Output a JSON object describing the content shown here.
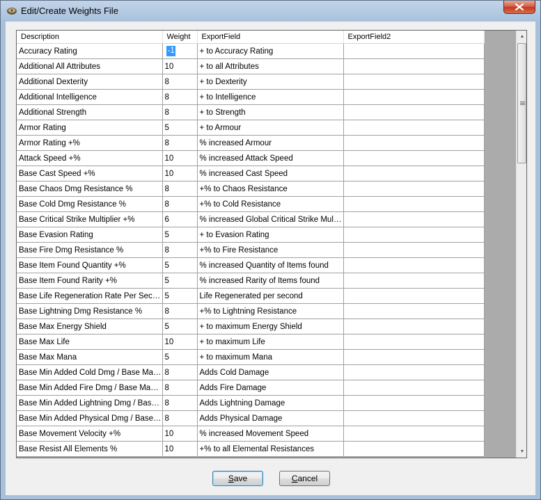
{
  "window": {
    "title": "Edit/Create Weights File",
    "close_glyph": "✕"
  },
  "table": {
    "columns": [
      "Description",
      "Weight",
      "ExportField",
      "ExportField2"
    ],
    "rows": [
      [
        "Accuracy Rating",
        "-1",
        "+ to Accuracy Rating",
        ""
      ],
      [
        "Additional All Attributes",
        "10",
        "+ to all Attributes",
        ""
      ],
      [
        "Additional Dexterity",
        "8",
        "+ to Dexterity",
        ""
      ],
      [
        "Additional Intelligence",
        "8",
        "+ to Intelligence",
        ""
      ],
      [
        "Additional Strength",
        "8",
        "+ to Strength",
        ""
      ],
      [
        "Armor Rating",
        "5",
        "+ to Armour",
        ""
      ],
      [
        "Armor Rating +%",
        "8",
        "% increased Armour",
        ""
      ],
      [
        "Attack Speed +%",
        "10",
        "% increased Attack Speed",
        ""
      ],
      [
        "Base Cast Speed +%",
        "10",
        "% increased Cast Speed",
        ""
      ],
      [
        "Base Chaos Dmg Resistance %",
        "8",
        "+% to Chaos Resistance",
        ""
      ],
      [
        "Base Cold Dmg Resistance %",
        "8",
        "+% to Cold Resistance",
        ""
      ],
      [
        "Base Critical Strike Multiplier +%",
        "6",
        "% increased Global Critical Strike Multiplier",
        ""
      ],
      [
        "Base Evasion Rating",
        "5",
        "+ to Evasion Rating",
        ""
      ],
      [
        "Base Fire Dmg Resistance %",
        "8",
        "+% to Fire Resistance",
        ""
      ],
      [
        "Base Item Found Quantity +%",
        "5",
        "% increased Quantity of Items found",
        ""
      ],
      [
        "Base Item Found Rarity +%",
        "5",
        "% increased Rarity of Items found",
        ""
      ],
      [
        "Base Life Regeneration Rate Per Second",
        "5",
        "Life Regenerated per second",
        ""
      ],
      [
        "Base Lightning Dmg Resistance %",
        "8",
        "+% to Lightning Resistance",
        ""
      ],
      [
        "Base Max Energy Shield",
        "5",
        "+ to maximum Energy Shield",
        ""
      ],
      [
        "Base Max Life",
        "10",
        "+ to maximum Life",
        ""
      ],
      [
        "Base Max Mana",
        "5",
        "+ to maximum Mana",
        ""
      ],
      [
        "Base Min Added Cold Dmg / Base Max ...",
        "8",
        "Adds Cold Damage",
        ""
      ],
      [
        "Base Min Added Fire Dmg / Base Max A...",
        "8",
        "Adds Fire Damage",
        ""
      ],
      [
        "Base Min Added Lightning Dmg / Base ...",
        "8",
        "Adds Lightning Damage",
        ""
      ],
      [
        "Base Min Added Physical Dmg / Base M...",
        "8",
        "Adds Physical Damage",
        ""
      ],
      [
        "Base Movement Velocity +%",
        "10",
        "% increased Movement Speed",
        ""
      ],
      [
        "Base Resist All Elements %",
        "10",
        "+% to all Elemental Resistances",
        ""
      ]
    ]
  },
  "buttons": {
    "save_mnemonic": "S",
    "save_rest": "ave",
    "cancel_mnemonic": "C",
    "cancel_rest": "ancel"
  },
  "scrollbar": {
    "up_glyph": "▲",
    "down_glyph": "▼"
  }
}
